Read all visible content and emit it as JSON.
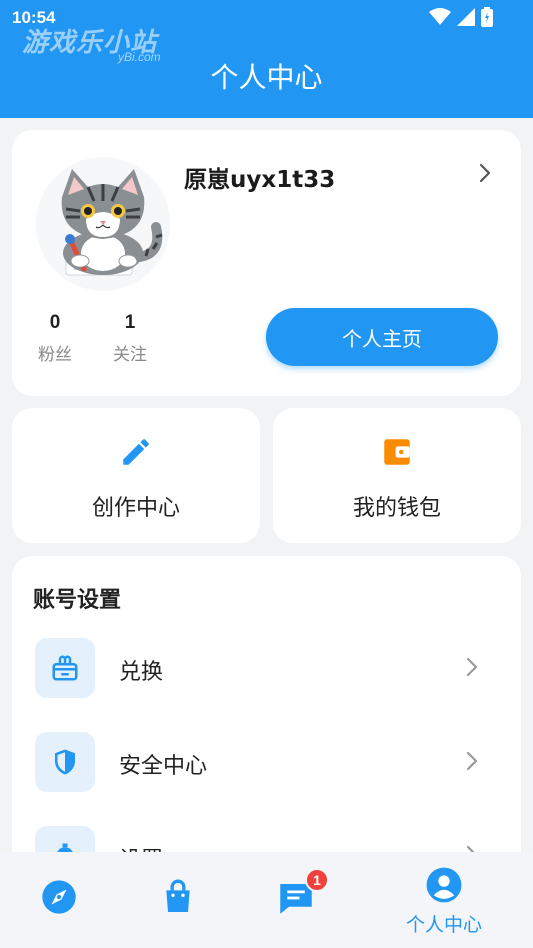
{
  "status_bar": {
    "time": "10:54"
  },
  "watermark": {
    "text": "游戏乐小站",
    "sub": "yBi.com"
  },
  "header": {
    "title": "个人中心"
  },
  "profile": {
    "username": "原崽uyx1t33",
    "stats": [
      {
        "value": "0",
        "label": "粉丝"
      },
      {
        "value": "1",
        "label": "关注"
      }
    ],
    "home_button": "个人主页"
  },
  "quick_tiles": [
    {
      "label": "创作中心",
      "icon": "pencil-icon"
    },
    {
      "label": "我的钱包",
      "icon": "wallet-icon"
    }
  ],
  "account_settings": {
    "title": "账号设置",
    "items": [
      {
        "label": "兑换",
        "icon": "gift-icon"
      },
      {
        "label": "安全中心",
        "icon": "shield-icon"
      },
      {
        "label": "设置",
        "icon": "gear-icon"
      }
    ]
  },
  "tabbar": {
    "items": [
      {
        "icon": "compass-icon",
        "label": ""
      },
      {
        "icon": "shopping-bag-icon",
        "label": ""
      },
      {
        "icon": "message-icon",
        "label": "",
        "badge": "1"
      },
      {
        "icon": "user-icon",
        "label": "个人中心",
        "active": true
      }
    ]
  },
  "colors": {
    "primary": "#2196f3",
    "wallet": "#fb8c00",
    "badge": "#f0413f",
    "background": "#f2f3f5"
  }
}
